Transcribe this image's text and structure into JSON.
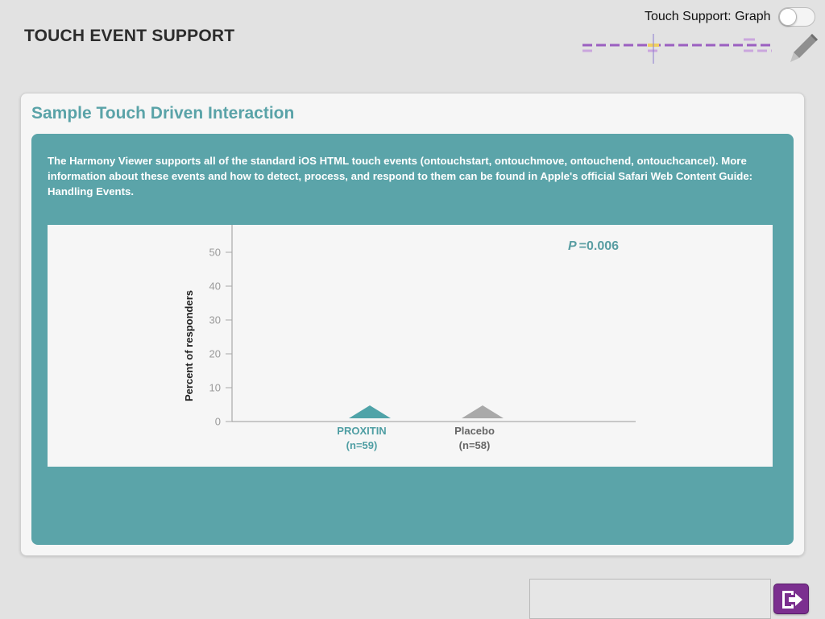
{
  "header": {
    "title": "TOUCH EVENT SUPPORT",
    "toggle_label": "Touch Support: Graph",
    "toggle_on": false
  },
  "card": {
    "title": "Sample Touch Driven Interaction",
    "description": "The Harmony Viewer supports all of the standard iOS HTML touch events (ontouchstart, ontouchmove, ontouchend, ontouchcancel). More information about these events and how to detect, process, and respond to them can be found in Apple's official Safari Web Content Guide: Handling Events."
  },
  "chart_data": {
    "type": "bar",
    "categories": [
      "PROXITIN",
      "Placebo"
    ],
    "category_sublabels": [
      "(n=59)",
      "(n=58)"
    ],
    "values": [
      0,
      0
    ],
    "series_colors": [
      "#4fa3a8",
      "#a9a9a9"
    ],
    "ylabel": "Percent of responders",
    "ylim": [
      0,
      55
    ],
    "yticks": [
      0,
      10,
      20,
      30,
      40,
      50
    ],
    "annotation_p": "P",
    "annotation_value": "=0.006",
    "annotation_color": "#5a9ea3"
  },
  "colors": {
    "accent": "#5ba4a9",
    "exit_button": "#7b2f8f",
    "scrubber": "#9b5fc0",
    "scrubber_marker": "#f0d060"
  },
  "icons": {
    "pencil": "pencil-icon",
    "exit": "exit-icon"
  }
}
